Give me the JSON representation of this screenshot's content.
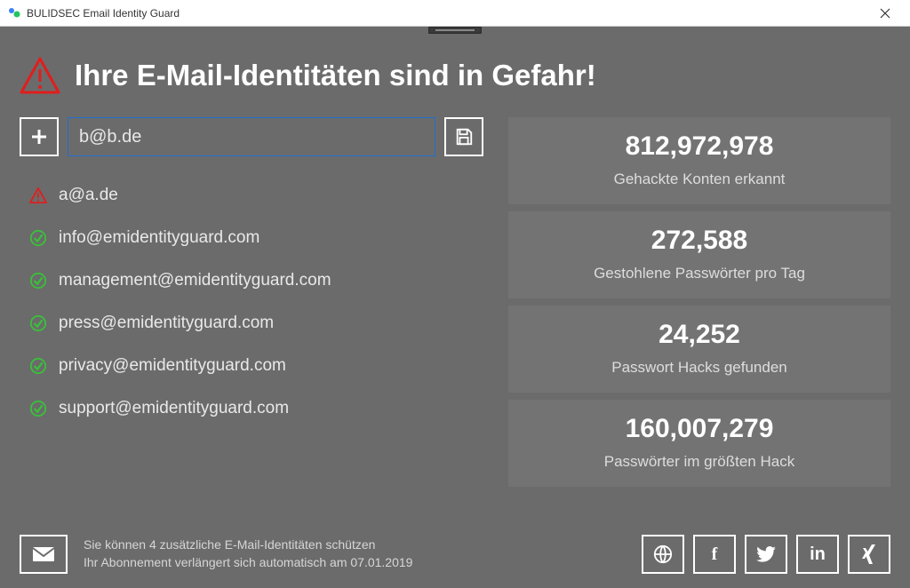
{
  "window": {
    "title": "BULIDSEC Email Identity Guard"
  },
  "header": {
    "title": "Ihre E-Mail-Identitäten sind in Gefahr!"
  },
  "input": {
    "value": "b@b.de"
  },
  "emails": [
    {
      "status": "danger",
      "address": "a@a.de"
    },
    {
      "status": "ok",
      "address": "info@emidentityguard.com"
    },
    {
      "status": "ok",
      "address": "management@emidentityguard.com"
    },
    {
      "status": "ok",
      "address": "press@emidentityguard.com"
    },
    {
      "status": "ok",
      "address": "privacy@emidentityguard.com"
    },
    {
      "status": "ok",
      "address": "support@emidentityguard.com"
    }
  ],
  "stats": [
    {
      "value": "812,972,978",
      "label": "Gehackte Konten erkannt"
    },
    {
      "value": "272,588",
      "label": "Gestohlene Passwörter pro Tag"
    },
    {
      "value": "24,252",
      "label": "Passwort Hacks gefunden"
    },
    {
      "value": "160,007,279",
      "label": "Passwörter im größten Hack"
    }
  ],
  "footer": {
    "line1": "Sie können 4 zusätzliche E-Mail-Identitäten schützen",
    "line2": "Ihr Abonnement verlängert sich automatisch am 07.01.2019"
  },
  "social": {
    "globe": "globe-icon",
    "facebook": "f",
    "twitter": "twitter-icon",
    "linkedin": "in",
    "xing": "xing-icon"
  }
}
